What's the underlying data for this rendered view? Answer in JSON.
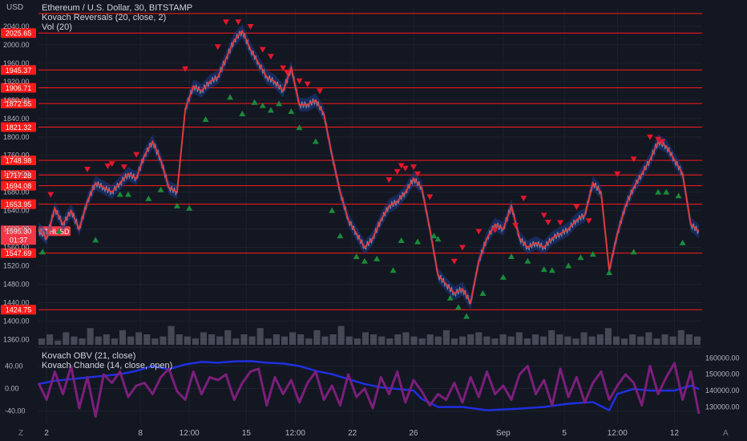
{
  "header": {
    "currency": "USD",
    "title": "Ethereum / U.S. Dollar, 30, BITSTAMP",
    "indicators": [
      "Kovach Reversals (20, close, 2)",
      "Vol (20)"
    ]
  },
  "lower_legend": [
    "Kovach OBV (21, close)",
    "Kovach Chande (14, close, open)"
  ],
  "footer": {
    "left_icon": "Z",
    "right_icon": "A"
  },
  "colors": {
    "background": "#131722",
    "grid": "#1e222d",
    "level": "#ff1a1a",
    "price": "#e03a3a",
    "band": "#1e3a8a",
    "up_marker": "#1b8a3a",
    "down_marker": "#e0172d",
    "obv": "#1f2fe0",
    "chande": "#7b1f7a",
    "axis_text": "#b2b5be",
    "current": "#f23645"
  },
  "chart_data": [
    {
      "type": "line",
      "name": "price",
      "title": "Ethereum / U.S. Dollar, 30, BITSTAMP",
      "ylabel": "USD",
      "ylim": [
        1345,
        2080
      ],
      "yticks": [
        1360,
        1400,
        1440,
        1480,
        1520,
        1560,
        1600,
        1640,
        1680,
        1720,
        1760,
        1800,
        1840,
        1880,
        1920,
        1960,
        2000,
        2040
      ],
      "ytick_labels": [
        "1360.00",
        "1400.00",
        "1440.00",
        "1480.00",
        "1520.00",
        "1560.00",
        "1600.00",
        "1640.00",
        "1680.00",
        "1720.00",
        "1760.00",
        "1800.00",
        "1840.00",
        "1880.00",
        "1920.00",
        "1960.00",
        "2000.00",
        "2040.00"
      ],
      "x_labels": [
        {
          "label": "2",
          "x": 2
        },
        {
          "label": "8",
          "x": 25
        },
        {
          "label": "12:00",
          "x": 37
        },
        {
          "label": "15",
          "x": 51
        },
        {
          "label": "12:00",
          "x": 63
        },
        {
          "label": "22",
          "x": 77
        },
        {
          "label": "26",
          "x": 92
        },
        {
          "label": "Sep",
          "x": 114
        },
        {
          "label": "5",
          "x": 129
        },
        {
          "label": "12:00",
          "x": 142
        },
        {
          "label": "12",
          "x": 156
        }
      ],
      "levels": [
        {
          "value": 2068,
          "label": ""
        },
        {
          "value": 2025.65,
          "label": "2025.65"
        },
        {
          "value": 1945.37,
          "label": "1945.37"
        },
        {
          "value": 1906.71,
          "label": "1906.71"
        },
        {
          "value": 1872.55,
          "label": "1872.55"
        },
        {
          "value": 1821.32,
          "label": "1821.32"
        },
        {
          "value": 1748.98,
          "label": "1748.98"
        },
        {
          "value": 1717.28,
          "label": "1717.28"
        },
        {
          "value": 1694.08,
          "label": "1694.08"
        },
        {
          "value": 1653.95,
          "label": "1653.95"
        },
        {
          "value": 1547.69,
          "label": "1547.69"
        },
        {
          "value": 1424.75,
          "label": "1424.75"
        }
      ],
      "current": {
        "value": 1595.3,
        "label": "1595.30",
        "countdown": "01:37",
        "symbol": "ETHUSD"
      },
      "x": [
        0,
        2,
        4,
        6,
        8,
        10,
        12,
        14,
        16,
        18,
        20,
        22,
        24,
        26,
        28,
        30,
        32,
        34,
        36,
        38,
        40,
        42,
        44,
        46,
        48,
        50,
        52,
        54,
        56,
        58,
        60,
        62,
        64,
        66,
        68,
        70,
        72,
        74,
        76,
        78,
        80,
        82,
        84,
        86,
        88,
        90,
        92,
        94,
        96,
        98,
        100,
        102,
        104,
        106,
        108,
        110,
        112,
        114,
        116,
        118,
        120,
        122,
        124,
        126,
        128,
        130,
        132,
        134,
        136,
        138,
        140,
        142,
        144,
        146,
        148,
        150,
        152,
        154,
        156,
        158,
        160,
        162
      ],
      "values": [
        1600,
        1580,
        1645,
        1610,
        1640,
        1600,
        1660,
        1700,
        1690,
        1680,
        1700,
        1720,
        1710,
        1760,
        1790,
        1750,
        1690,
        1680,
        1860,
        1910,
        1900,
        1920,
        1930,
        1970,
        2010,
        2030,
        1990,
        1960,
        1930,
        1920,
        1900,
        1950,
        1870,
        1870,
        1880,
        1850,
        1760,
        1680,
        1620,
        1590,
        1560,
        1580,
        1620,
        1650,
        1660,
        1680,
        1710,
        1690,
        1600,
        1500,
        1480,
        1460,
        1470,
        1440,
        1530,
        1580,
        1610,
        1600,
        1650,
        1580,
        1560,
        1570,
        1560,
        1580,
        1590,
        1600,
        1620,
        1630,
        1700,
        1680,
        1510,
        1590,
        1650,
        1690,
        1720,
        1750,
        1790,
        1780,
        1750,
        1720,
        1610,
        1595
      ],
      "band_width": 30,
      "down_markers": [
        [
          3,
          1675
        ],
        [
          12,
          1730
        ],
        [
          17,
          1737
        ],
        [
          18,
          1742
        ],
        [
          21,
          1735
        ],
        [
          24,
          1762
        ],
        [
          36,
          1948
        ],
        [
          44,
          1996
        ],
        [
          46,
          2050
        ],
        [
          49,
          2050
        ],
        [
          52,
          2040
        ],
        [
          55,
          1990
        ],
        [
          57,
          1975
        ],
        [
          60,
          1950
        ],
        [
          61,
          1940
        ],
        [
          64,
          1922
        ],
        [
          66,
          1915
        ],
        [
          69,
          1900
        ],
        [
          86,
          1707
        ],
        [
          88,
          1725
        ],
        [
          89,
          1738
        ],
        [
          90,
          1732
        ],
        [
          92,
          1735
        ],
        [
          93,
          1720
        ],
        [
          96,
          1670
        ],
        [
          102,
          1530
        ],
        [
          104,
          1560
        ],
        [
          108,
          1595
        ],
        [
          112,
          1598
        ],
        [
          117,
          1608
        ],
        [
          119,
          1667
        ],
        [
          124,
          1630
        ],
        [
          125,
          1615
        ],
        [
          128,
          1614
        ],
        [
          132,
          1648
        ],
        [
          135,
          1618
        ],
        [
          142,
          1720
        ],
        [
          146,
          1752
        ],
        [
          150,
          1800
        ],
        [
          152,
          1795
        ],
        [
          153,
          1790
        ]
      ],
      "up_markers": [
        [
          1,
          1550
        ],
        [
          5,
          1595
        ],
        [
          14,
          1576
        ],
        [
          20,
          1675
        ],
        [
          22,
          1675
        ],
        [
          27,
          1666
        ],
        [
          30,
          1685
        ],
        [
          34,
          1650
        ],
        [
          37,
          1645
        ],
        [
          41,
          1838
        ],
        [
          47,
          1886
        ],
        [
          50,
          1850
        ],
        [
          53,
          1875
        ],
        [
          55,
          1868
        ],
        [
          57,
          1858
        ],
        [
          59,
          1872
        ],
        [
          62,
          1855
        ],
        [
          64,
          1820
        ],
        [
          68,
          1790
        ],
        [
          72,
          1640
        ],
        [
          74,
          1585
        ],
        [
          78,
          1540
        ],
        [
          80,
          1530
        ],
        [
          83,
          1535
        ],
        [
          87,
          1510
        ],
        [
          89,
          1575
        ],
        [
          93,
          1572
        ],
        [
          97,
          1585
        ],
        [
          98,
          1578
        ],
        [
          101,
          1450
        ],
        [
          103,
          1430
        ],
        [
          105,
          1410
        ],
        [
          109,
          1460
        ],
        [
          114,
          1495
        ],
        [
          116,
          1540
        ],
        [
          120,
          1530
        ],
        [
          124,
          1512
        ],
        [
          126,
          1510
        ],
        [
          130,
          1520
        ],
        [
          133,
          1538
        ],
        [
          136,
          1545
        ],
        [
          140,
          1505
        ],
        [
          146,
          1550
        ],
        [
          152,
          1680
        ],
        [
          154,
          1680
        ],
        [
          157,
          1672
        ],
        [
          158,
          1570
        ]
      ]
    },
    {
      "type": "bar",
      "name": "volume",
      "ylim": [
        0,
        1
      ],
      "values": [
        0.3,
        0.5,
        0.2,
        0.6,
        0.4,
        0.3,
        0.8,
        0.4,
        0.5,
        0.3,
        0.7,
        0.4,
        0.6,
        0.5,
        0.3,
        0.4,
        0.9,
        0.5,
        0.4,
        0.3,
        0.6,
        0.5,
        0.4,
        0.7,
        0.3,
        0.5,
        0.4,
        0.8,
        0.3,
        0.5,
        0.4,
        0.6,
        0.5,
        0.3,
        0.7,
        0.4,
        0.5,
        0.9,
        0.4,
        0.3,
        0.6,
        0.5,
        0.4,
        0.3,
        0.5,
        0.6,
        0.4,
        0.3,
        0.5,
        0.4,
        0.7,
        0.3,
        0.4,
        0.5,
        0.6,
        0.4,
        0.3,
        0.5,
        0.4,
        0.6,
        0.3,
        0.5,
        0.4,
        0.7,
        0.5,
        0.4,
        0.3,
        0.6,
        0.4,
        0.5,
        0.8,
        0.4,
        0.3,
        0.5,
        0.4,
        0.6,
        0.3,
        0.5,
        0.4,
        0.7,
        0.5,
        0.4
      ]
    },
    {
      "type": "line",
      "name": "oscillators",
      "ylim": [
        -62,
        72
      ],
      "yticks": [
        -40,
        0,
        40
      ],
      "ytick_labels": [
        "-40.00",
        "0.00",
        "40.00"
      ],
      "right_ylim": [
        120000,
        166000
      ],
      "right_yticks": [
        130000,
        140000,
        150000,
        160000
      ],
      "right_ytick_labels": [
        "130000.00",
        "140000.00",
        "150000.00",
        "160000.00"
      ],
      "series": [
        {
          "name": "Kovach OBV (21, close)",
          "axis": "right",
          "x": [
            0,
            4,
            8,
            12,
            16,
            20,
            24,
            28,
            32,
            36,
            40,
            44,
            48,
            52,
            56,
            60,
            64,
            68,
            72,
            76,
            80,
            84,
            88,
            92,
            94,
            98,
            104,
            110,
            118,
            124,
            130,
            136,
            140,
            142,
            146,
            150,
            156,
            160,
            162
          ],
          "values": [
            144000,
            146000,
            147000,
            148000,
            149000,
            150000,
            152000,
            155000,
            153000,
            156000,
            157500,
            157000,
            157800,
            158000,
            157000,
            156500,
            155000,
            152000,
            150000,
            147000,
            144000,
            142000,
            141000,
            140000,
            135000,
            130000,
            130000,
            128000,
            129000,
            130000,
            132000,
            133000,
            128000,
            138000,
            141000,
            140000,
            140000,
            143000,
            141000
          ]
        },
        {
          "name": "Kovach Chande (14, close, open)",
          "axis": "left",
          "x": [
            0,
            2,
            4,
            6,
            8,
            10,
            12,
            14,
            16,
            18,
            20,
            22,
            24,
            26,
            28,
            30,
            32,
            34,
            36,
            38,
            40,
            42,
            44,
            46,
            48,
            50,
            52,
            54,
            56,
            58,
            60,
            62,
            64,
            66,
            68,
            70,
            72,
            74,
            76,
            78,
            80,
            82,
            84,
            86,
            88,
            90,
            92,
            94,
            96,
            98,
            100,
            102,
            104,
            106,
            108,
            110,
            112,
            114,
            116,
            118,
            120,
            122,
            124,
            126,
            128,
            130,
            132,
            134,
            136,
            138,
            140,
            142,
            144,
            146,
            148,
            150,
            152,
            154,
            156,
            158,
            160,
            162
          ],
          "values": [
            10,
            -20,
            30,
            -10,
            40,
            -35,
            20,
            -50,
            25,
            10,
            30,
            -15,
            5,
            10,
            -10,
            20,
            35,
            -5,
            -20,
            30,
            -10,
            20,
            15,
            25,
            -20,
            10,
            30,
            35,
            -30,
            20,
            -10,
            15,
            -25,
            10,
            30,
            -20,
            5,
            -30,
            25,
            -15,
            0,
            -35,
            20,
            -10,
            30,
            -25,
            15,
            -5,
            -30,
            -10,
            -20,
            10,
            -25,
            20,
            -15,
            30,
            -10,
            5,
            -20,
            25,
            40,
            -10,
            15,
            -30,
            35,
            -15,
            20,
            -25,
            10,
            30,
            -20,
            5,
            25,
            10,
            -30,
            40,
            -10,
            20,
            45,
            -20,
            30,
            -45
          ]
        }
      ]
    }
  ]
}
